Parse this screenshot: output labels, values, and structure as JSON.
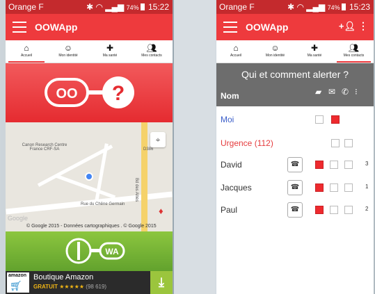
{
  "status": {
    "carrier": "Orange F",
    "signal_text": "74%",
    "time_left": "15:22",
    "time_right": "15:23"
  },
  "app": {
    "title": "OOWApp"
  },
  "tabs": [
    {
      "label": "Accueil",
      "icon": "home-icon"
    },
    {
      "label": "Mon identité",
      "icon": "face-icon"
    },
    {
      "label": "Ma santé",
      "icon": "medical-cross-icon"
    },
    {
      "label": "Mes contacts",
      "icon": "group-icon"
    }
  ],
  "home": {
    "hero_logo_text": "OO",
    "map_labels": {
      "place": "Canon Research Centre France CRF-SA",
      "road_number": "D386",
      "street_vertical": "Bd des Alliés",
      "street_bottom": "Rue du Chêne Germain"
    },
    "map_copyright": "© Google 2015 - Données cartographiques . © Google 2015",
    "map_google_logo": "Google",
    "wa_logo_text": "WA"
  },
  "ad": {
    "brand": "amazon",
    "title": "Boutique Amazon",
    "price": "GRATUIT",
    "stars": "★★★★★",
    "reviews": "(98 619)",
    "rating": 4.5
  },
  "contacts": {
    "heading": "Qui et comment alerter ?",
    "name_column": "Nom",
    "rows": [
      {
        "name": "Moi",
        "style": "blue",
        "phone": false,
        "checks": [
          false,
          true
        ],
        "count": ""
      },
      {
        "name": "Urgence (112)",
        "style": "red",
        "phone": false,
        "checks": [
          false,
          false
        ],
        "count": ""
      },
      {
        "name": "David",
        "style": "dark",
        "phone": true,
        "checks": [
          true,
          false,
          false
        ],
        "count": "3"
      },
      {
        "name": "Jacques",
        "style": "dark",
        "phone": true,
        "checks": [
          true,
          false,
          false
        ],
        "count": "1"
      },
      {
        "name": "Paul",
        "style": "dark",
        "phone": true,
        "checks": [
          true,
          false,
          false
        ],
        "count": "2"
      }
    ]
  },
  "colors": {
    "brand_red": "#ee3a3d",
    "status_red": "#c42a2d",
    "green": "#8cc63f",
    "header_grey": "#6d6d6d",
    "check_red": "#ee2a2e",
    "name_blue": "#3b5ec9"
  }
}
